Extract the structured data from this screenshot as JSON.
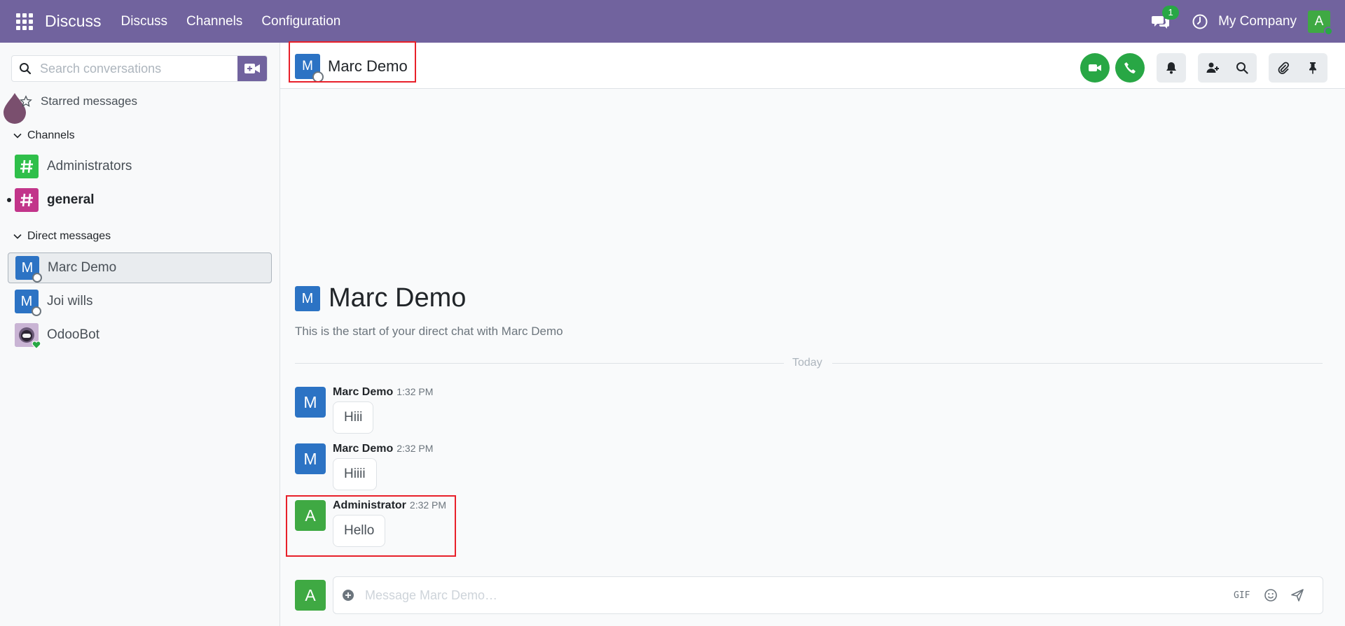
{
  "navbar": {
    "brand": "Discuss",
    "menus": [
      "Discuss",
      "Channels",
      "Configuration"
    ],
    "chat_badge": "1",
    "company": "My Company",
    "user_initial": "A",
    "bg_color": "#71639e"
  },
  "sidebar": {
    "search_placeholder": "Search conversations",
    "starred_label": "Starred messages",
    "channels_header": "Channels",
    "channels": [
      {
        "name": "Administrators",
        "color": "#2fbf4a",
        "unread": false
      },
      {
        "name": "general",
        "color": "#c2358a",
        "unread": true
      }
    ],
    "dm_header": "Direct messages",
    "direct_messages": [
      {
        "name": "Marc Demo",
        "initial": "M",
        "active": true
      },
      {
        "name": "Joi wills",
        "initial": "M",
        "active": false
      },
      {
        "name": "OdooBot",
        "initial": "",
        "active": false
      }
    ]
  },
  "thread": {
    "header_name": "Marc Demo",
    "header_initial": "M",
    "intro_name": "Marc Demo",
    "intro_initial": "M",
    "intro_text": "This is the start of your direct chat with Marc Demo",
    "date_divider": "Today",
    "messages": [
      {
        "author": "Marc Demo",
        "time": "1:32 PM",
        "text": "Hiii",
        "initial": "M",
        "color": "#2c73c4"
      },
      {
        "author": "Marc Demo",
        "time": "2:32 PM",
        "text": "Hiiii",
        "initial": "M",
        "color": "#2c73c4"
      },
      {
        "author": "Administrator",
        "time": "2:32 PM",
        "text": "Hello",
        "initial": "A",
        "color": "#3fa943"
      }
    ],
    "composer_initial": "A",
    "composer_placeholder": "Message Marc Demo…",
    "gif_label": "GIF"
  },
  "icons": [
    "apps-icon",
    "chat-icon",
    "clock-icon",
    "search-icon",
    "video-call-icon",
    "phone-icon",
    "bell-icon",
    "add-user-icon",
    "paperclip-icon",
    "pin-icon",
    "star-icon",
    "chevron-down-icon",
    "plus-circle-icon",
    "emoji-icon",
    "send-icon"
  ]
}
